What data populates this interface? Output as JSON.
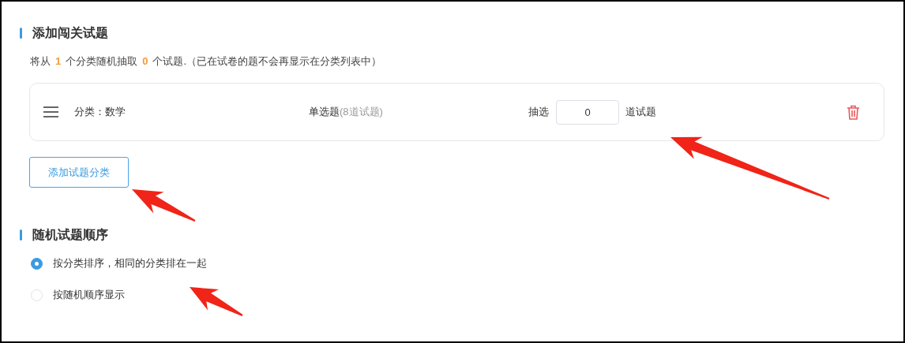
{
  "sections": [
    {
      "title": "添加闯关试题"
    },
    {
      "title": "随机试题顺序"
    }
  ],
  "summary": [
    {
      "kind": "plain",
      "text": "将从"
    },
    {
      "kind": "count",
      "text": "1"
    },
    {
      "kind": "plain",
      "text": "个分类随机抽取"
    },
    {
      "kind": "count",
      "text": "0"
    },
    {
      "kind": "plain",
      "text": "个试题.（已在试卷的题不会再显示在分类列表中）"
    }
  ],
  "categories": [
    {
      "name": "分类：数学",
      "type": "单选题",
      "type_count": "(8道试题)",
      "pick_label": "抽选",
      "pick_value": "0",
      "pick_unit": "道试题"
    }
  ],
  "add_button": "添加试题分类",
  "order_options": [
    {
      "label": "按分类排序，相同的分类排在一起",
      "selected": true
    },
    {
      "label": "按随机顺序显示",
      "selected": false
    }
  ]
}
